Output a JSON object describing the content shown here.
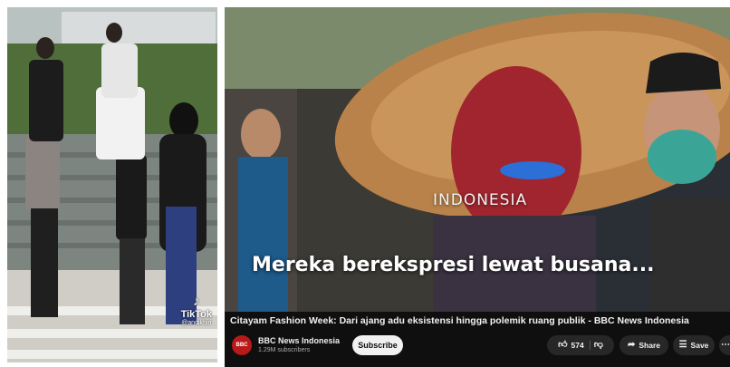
{
  "tiktok": {
    "logo_glyph": "♪",
    "brand": "TikTok",
    "handle": "@andikhiri"
  },
  "video": {
    "watermark": "INDONESIA",
    "subtitle": "Mereka berekspresi lewat busana...",
    "title": "Citayam Fashion Week: Dari ajang adu eksistensi hingga polemik ruang publik - BBC News Indonesia"
  },
  "channel": {
    "avatar_text": "BBC",
    "name": "BBC News Indonesia",
    "subscribers": "1.29M subscribers"
  },
  "actions": {
    "subscribe_label": "Subscribe",
    "like_count": "574",
    "share_label": "Share",
    "save_label": "Save"
  },
  "icons": {
    "like": "thumbs-up-icon",
    "dislike": "thumbs-down-icon",
    "share": "share-arrow-icon",
    "save": "save-playlist-icon",
    "more": "more-icon"
  },
  "colors": {
    "youtube_bg": "#0f0f0f",
    "bbc_red": "#bb1919",
    "subscribe_bg": "#f1f1f1",
    "pill_bg": "#272727"
  }
}
